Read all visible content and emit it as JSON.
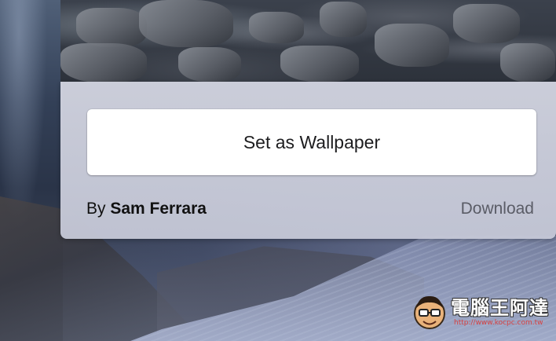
{
  "panel": {
    "set_wallpaper_label": "Set as Wallpaper",
    "credit_prefix": "By",
    "author_name": "Sam Ferrara",
    "download_label": "Download"
  },
  "watermark": {
    "brand_text": "電腦王阿達",
    "url_text": "http://www.kocpc.com.tw"
  },
  "colors": {
    "panel_background": "#cfd1dd",
    "button_background": "#ffffff",
    "primary_text": "#111111",
    "secondary_text": "#5a5c66"
  },
  "icons": {
    "watermark_mascot": "mascot-face-icon"
  }
}
